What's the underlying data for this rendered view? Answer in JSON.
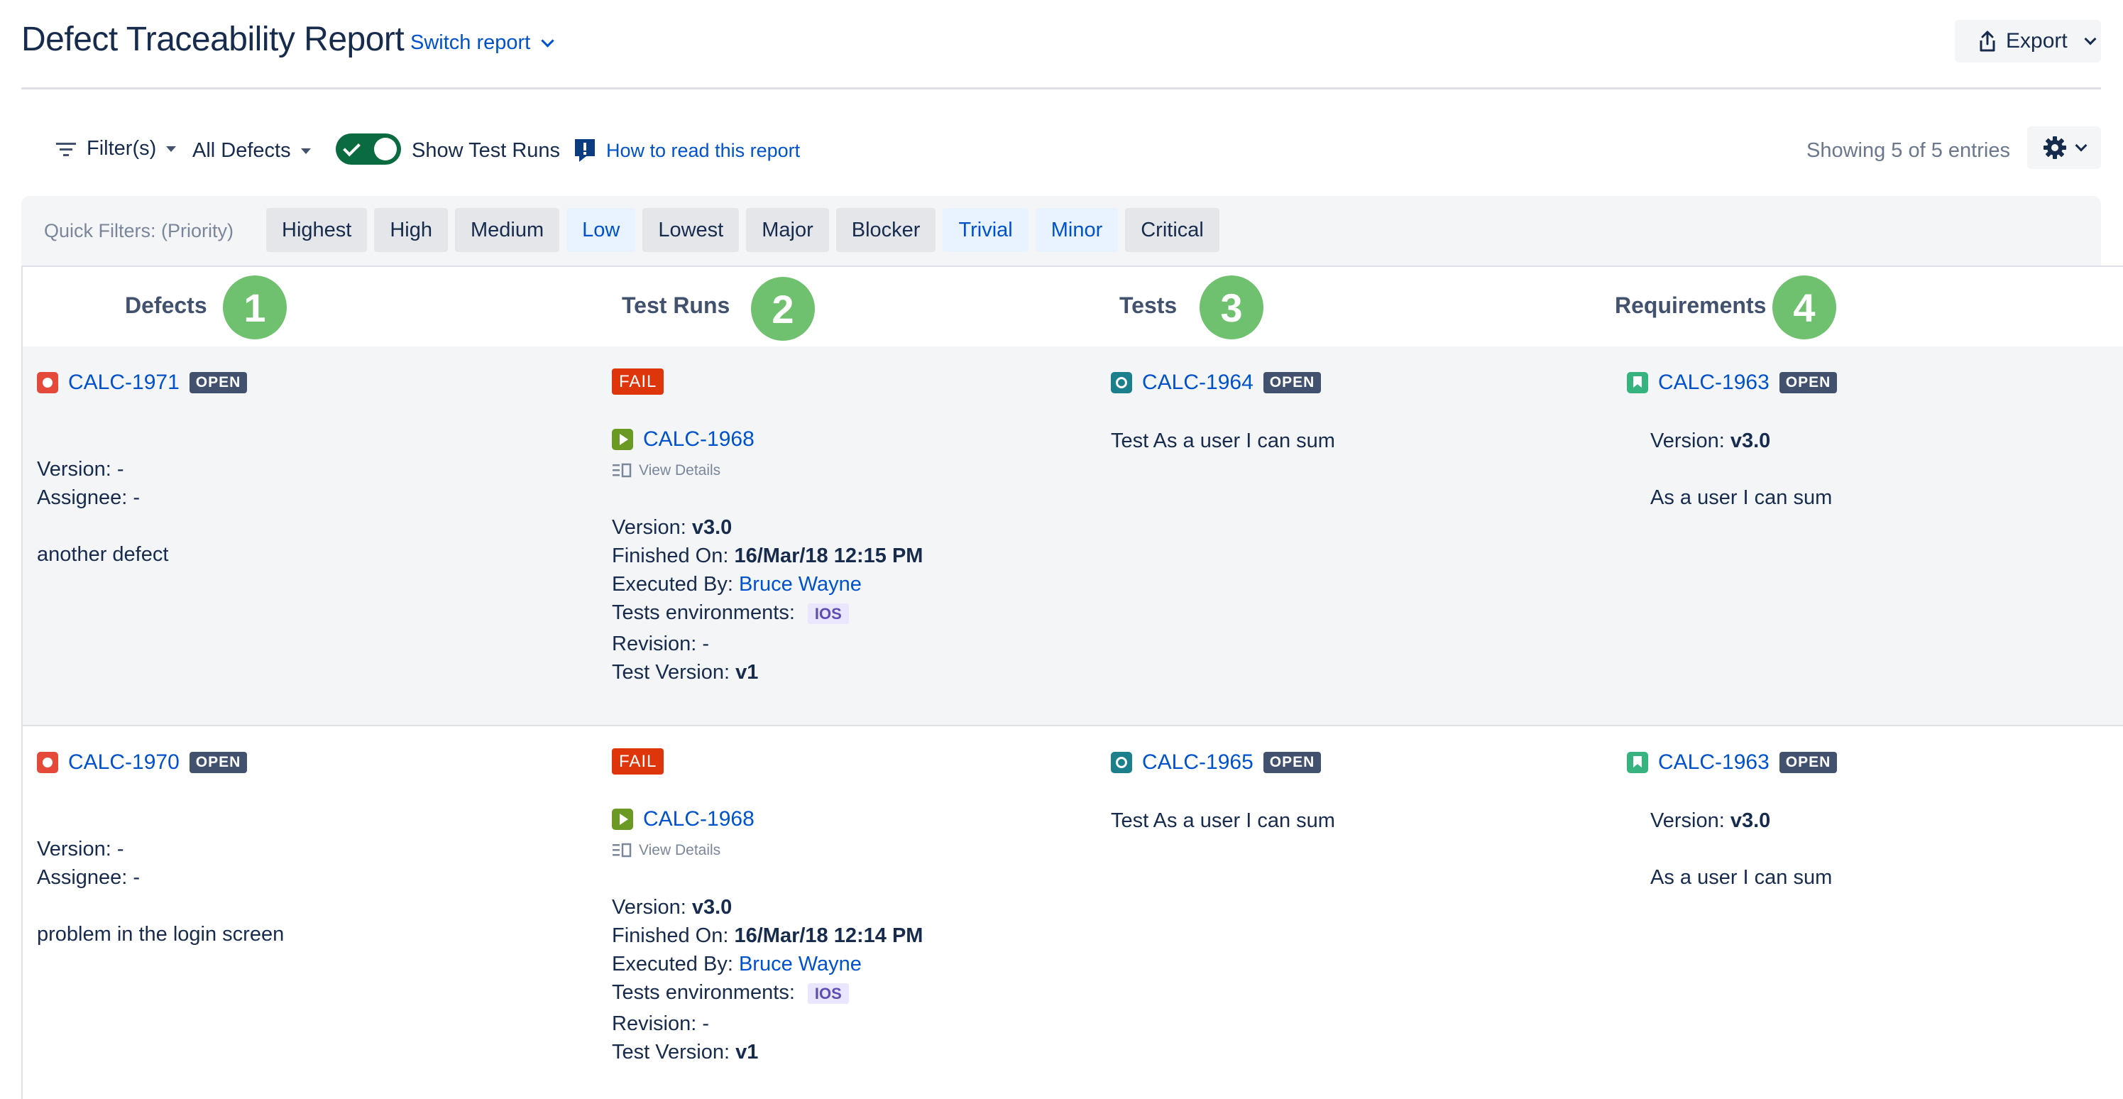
{
  "header": {
    "title": "Defect Traceability Report",
    "switch_report": "Switch report",
    "export": "Export"
  },
  "toolbar": {
    "filters": "Filter(s)",
    "all_defects": "All Defects",
    "show_test_runs": "Show Test Runs",
    "show_test_runs_on": true,
    "how_to_read": "How to read this report",
    "showing": "Showing 5 of 5 entries"
  },
  "quick_filters": {
    "label": "Quick Filters: (Priority)",
    "chips": [
      {
        "label": "Highest",
        "selected": false
      },
      {
        "label": "High",
        "selected": false
      },
      {
        "label": "Medium",
        "selected": false
      },
      {
        "label": "Low",
        "selected": true
      },
      {
        "label": "Lowest",
        "selected": false
      },
      {
        "label": "Major",
        "selected": false
      },
      {
        "label": "Blocker",
        "selected": false
      },
      {
        "label": "Trivial",
        "selected": true
      },
      {
        "label": "Minor",
        "selected": true
      },
      {
        "label": "Critical",
        "selected": false
      }
    ]
  },
  "columns": [
    {
      "label": "Defects",
      "number": "1"
    },
    {
      "label": "Test Runs",
      "number": "2"
    },
    {
      "label": "Tests",
      "number": "3"
    },
    {
      "label": "Requirements",
      "number": "4"
    }
  ],
  "labels": {
    "version": "Version:",
    "assignee": "Assignee:",
    "finished_on": "Finished On:",
    "executed_by": "Executed By:",
    "tests_environments": "Tests environments:",
    "revision": "Revision:",
    "test_version": "Test Version:",
    "view_details": "View Details"
  },
  "rows": [
    {
      "defect": {
        "key": "CALC-1971",
        "status": "OPEN",
        "version": "-",
        "assignee": "-",
        "summary": "another defect"
      },
      "test_run": {
        "result": "FAIL",
        "key": "CALC-1968",
        "version": "v3.0",
        "finished_on": "16/Mar/18 12:15 PM",
        "executed_by": "Bruce Wayne",
        "environment": "IOS",
        "revision": "-",
        "test_version": "v1"
      },
      "test": {
        "key": "CALC-1964",
        "status": "OPEN",
        "summary": "Test As a user I can sum"
      },
      "requirement": {
        "key": "CALC-1963",
        "status": "OPEN",
        "version": "v3.0",
        "summary": "As a user I can sum"
      }
    },
    {
      "defect": {
        "key": "CALC-1970",
        "status": "OPEN",
        "version": "-",
        "assignee": "-",
        "summary": "problem in the login screen"
      },
      "test_run": {
        "result": "FAIL",
        "key": "CALC-1968",
        "version": "v3.0",
        "finished_on": "16/Mar/18 12:14 PM",
        "executed_by": "Bruce Wayne",
        "environment": "IOS",
        "revision": "-",
        "test_version": "v1"
      },
      "test": {
        "key": "CALC-1965",
        "status": "OPEN",
        "summary": "Test As a user I can sum"
      },
      "requirement": {
        "key": "CALC-1963",
        "status": "OPEN",
        "version": "v3.0",
        "summary": "As a user I can sum"
      }
    }
  ]
}
